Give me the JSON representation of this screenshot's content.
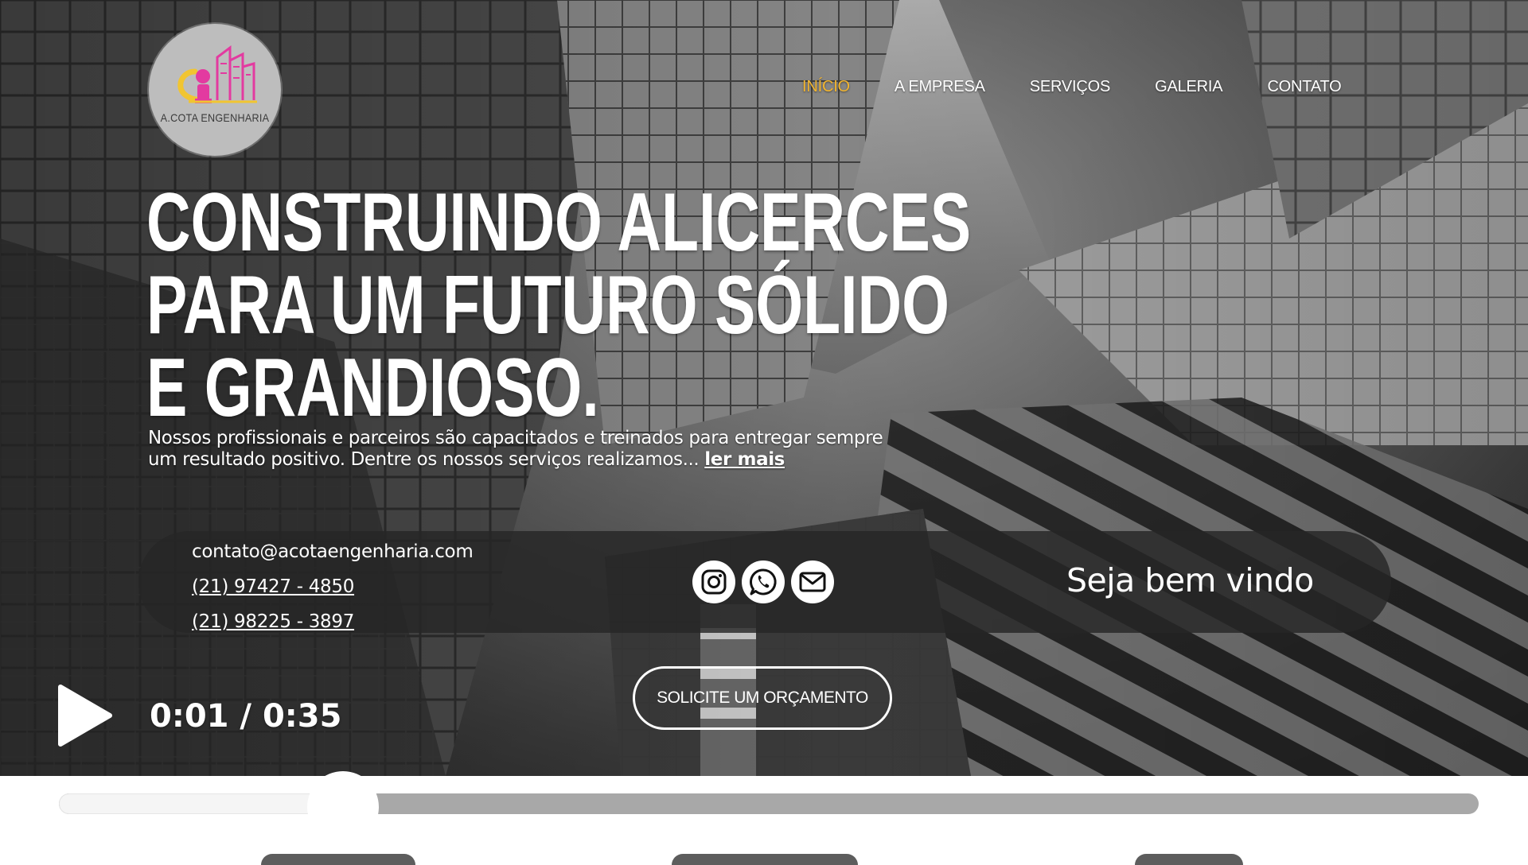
{
  "brand": {
    "logo_text": "A.COTA ENGENHARIA",
    "logo_colors": {
      "primary": "#e33aa0",
      "accent": "#f1c531",
      "bg": "#bdbdbd"
    }
  },
  "nav": {
    "items": [
      {
        "label": "INÍCIO",
        "active": true
      },
      {
        "label": "A EMPRESA",
        "active": false
      },
      {
        "label": "SERVIÇOS",
        "active": false
      },
      {
        "label": "GALERIA",
        "active": false
      },
      {
        "label": "CONTATO",
        "active": false
      }
    ],
    "active_color": "#f1b42f"
  },
  "hero": {
    "headline": [
      "CONSTRUINDO ALICERCES",
      "PARA UM FUTURO SÓLIDO",
      "E GRANDIOSO."
    ],
    "intro_text": "Nossos profissionais e parceiros são capacitados e treinados para entregar sempre um resultado positivo. Dentre os nossos serviços realizamos...",
    "read_more": "ler mais"
  },
  "contact": {
    "email": "contato@acotaengenharia.com",
    "phones": [
      "(21) 97427 - 4850",
      "(21) 98225 - 3897"
    ],
    "socials": [
      {
        "icon": "instagram-icon"
      },
      {
        "icon": "whatsapp-icon"
      },
      {
        "icon": "mail-icon"
      }
    ],
    "welcome": "Seja bem vindo"
  },
  "cta": {
    "label": "SOLICITE UM ORÇAMENTO"
  },
  "video": {
    "time": "0:01 / 0:35",
    "current_seconds": 1,
    "duration_seconds": 35,
    "progress_fraction": 0.2
  }
}
